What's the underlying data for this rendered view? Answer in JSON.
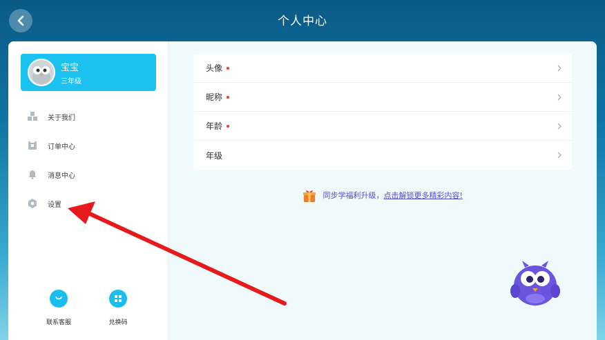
{
  "header": {
    "title": "个人中心"
  },
  "profile": {
    "name": "宝宝",
    "grade": "三年级"
  },
  "sidebar": {
    "items": [
      {
        "label": "关于我们"
      },
      {
        "label": "订单中心"
      },
      {
        "label": "消息中心"
      },
      {
        "label": "设置"
      }
    ]
  },
  "bottom_actions": [
    {
      "label": "联系客服"
    },
    {
      "label": "兑换码"
    }
  ],
  "rows": [
    {
      "label": "头像"
    },
    {
      "label": "昵称"
    },
    {
      "label": "年龄"
    },
    {
      "label": "年级"
    }
  ],
  "promo": {
    "text": "同步学福利升级，",
    "link": "点击解锁更多精彩内容!"
  },
  "colors": {
    "accent": "#1bc2ef",
    "dot": "#e8412c",
    "promo": "#5a4ad1",
    "annotation_arrow": "#e8191b"
  }
}
